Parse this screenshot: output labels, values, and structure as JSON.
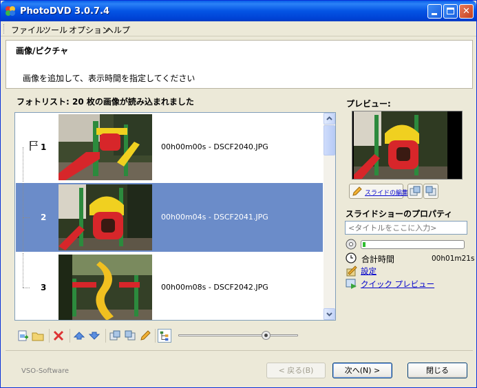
{
  "window": {
    "title": "PhotoDVD 3.0.7.4"
  },
  "menu": {
    "items": [
      "ファイル",
      "ツール",
      "オプション",
      "ヘルプ"
    ]
  },
  "header": {
    "title": "画像/ピクチャ",
    "description": "画像を追加して、表示時間を指定してください"
  },
  "photo_list": {
    "label": "フォトリスト: 20 枚の画像が読み込まれました",
    "rows": [
      {
        "number": "1",
        "caption": "00h00m00s - DSCF2040.JPG",
        "selected": false,
        "flagged": true
      },
      {
        "number": "2",
        "caption": "00h00m04s - DSCF2041.JPG",
        "selected": true,
        "flagged": false
      },
      {
        "number": "3",
        "caption": "00h00m08s - DSCF2042.JPG",
        "selected": false,
        "flagged": false
      }
    ]
  },
  "toolbar": {
    "icons": [
      "add-image-icon",
      "add-folder-icon",
      "delete-icon",
      "move-up-icon",
      "move-down-icon",
      "rotate-left-icon",
      "rotate-right-icon",
      "edit-pencil-icon",
      "tree-view-icon"
    ],
    "zoom_level_fraction": 0.73
  },
  "preview": {
    "label": "プレビュー:",
    "edit_button": "スライドの編集"
  },
  "properties": {
    "label": "スライドショーのプロパティ",
    "title_placeholder": "<タイトルをここに入力>",
    "disc_usage_fraction": 0.03,
    "total_time_label": "合計時間",
    "total_time_value": "00h01m21s",
    "settings_link": "設定",
    "quick_preview_link": "クイック プレビュー"
  },
  "footer": {
    "brand": "VSO-Software",
    "back_button": "< 戻る(B)",
    "next_button": "次へ(N) >",
    "close_button": "閉じる"
  },
  "colors": {
    "title_bar": "#0454e4",
    "selection": "#6b8cc9",
    "link": "#0000cc",
    "progress": "#2fbd2f"
  }
}
